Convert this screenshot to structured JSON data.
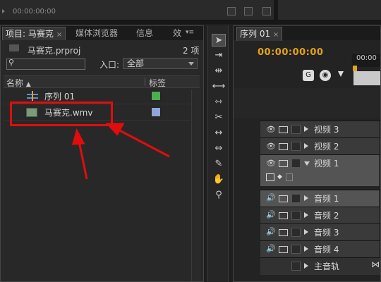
{
  "top": {
    "timecode": "00:00:00:00"
  },
  "project": {
    "tabs": [
      {
        "label": "项目: 马赛克",
        "active": true,
        "close": "×"
      },
      {
        "label": "媒体浏览器",
        "active": false
      },
      {
        "label": "信息",
        "active": false
      },
      {
        "label": "效",
        "active": false
      }
    ],
    "file_name": "马赛克.prproj",
    "item_count": "2 项",
    "search_placeholder": "",
    "inpoint_label": "入口:",
    "inpoint_value": "全部",
    "col_name": "名称",
    "col_label": "标签",
    "items": [
      {
        "name": "序列 01",
        "color": "#4caf50",
        "icon": "sequence-icon"
      },
      {
        "name": "马赛克.wmv",
        "color": "#8fa6d8",
        "icon": "video-file-icon"
      }
    ]
  },
  "annotation": {
    "color": "#e10d0d"
  },
  "tools": [
    "select-tool",
    "track-select-tool",
    "ripple-edit-tool",
    "rolling-edit-tool",
    "rate-stretch-tool",
    "razor-tool",
    "slip-tool",
    "slide-tool",
    "pen-tool",
    "hand-tool",
    "zoom-tool"
  ],
  "timeline": {
    "tab_label": "序列 01",
    "timecode": "00:00:00:00",
    "ruler": "00:00",
    "tracks": [
      {
        "name": "视频 3",
        "kind": "video"
      },
      {
        "name": "视频 2",
        "kind": "video"
      },
      {
        "name": "视频 1",
        "kind": "video"
      },
      {
        "name": "音频 1",
        "kind": "audio"
      },
      {
        "name": "音频 2",
        "kind": "audio"
      },
      {
        "name": "音频 3",
        "kind": "audio"
      },
      {
        "name": "音频 4",
        "kind": "audio"
      },
      {
        "name": "主音轨",
        "kind": "master"
      }
    ]
  }
}
